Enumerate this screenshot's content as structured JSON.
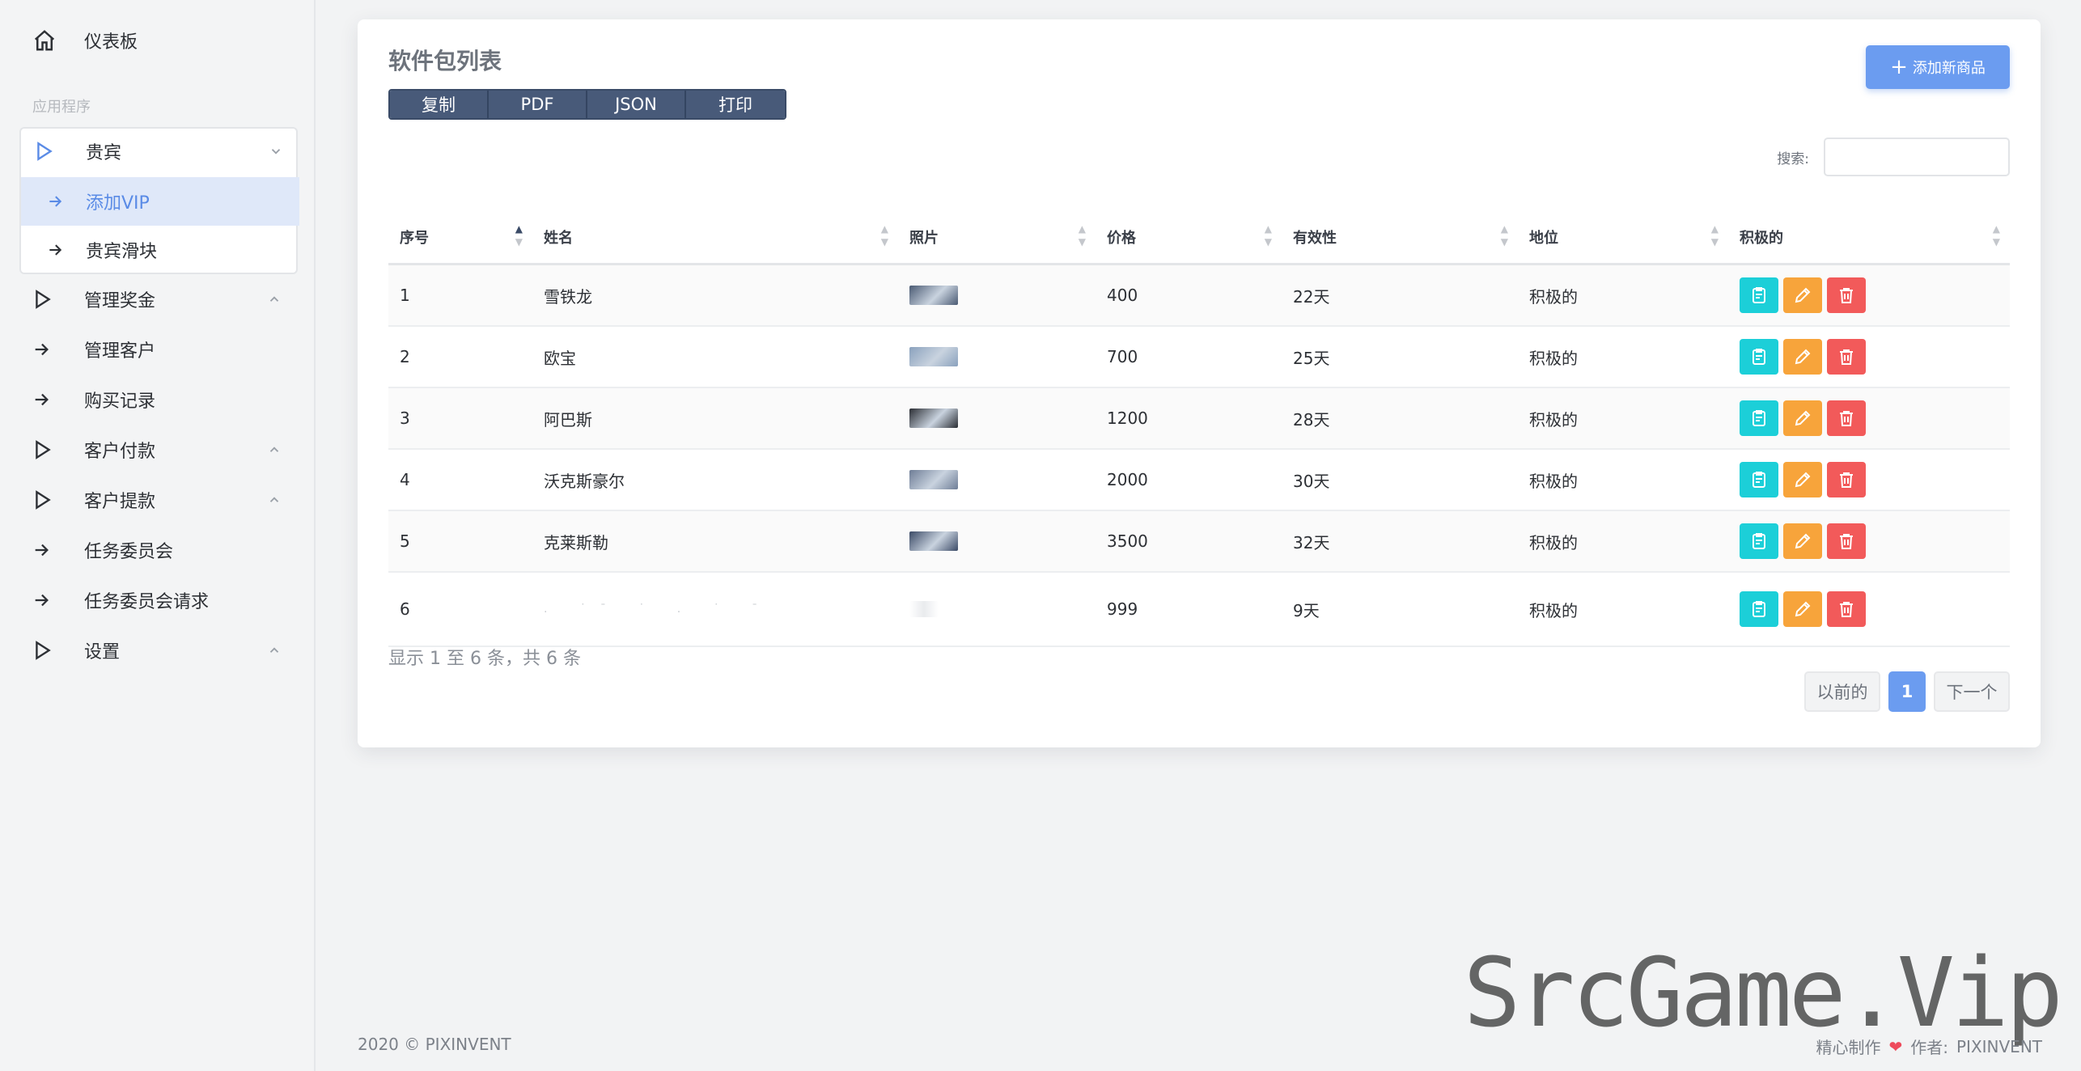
{
  "sidebar": {
    "dashboard": "仪表板",
    "section": "应用程序",
    "vip": {
      "label": "贵宾",
      "children": [
        "添加VIP",
        "贵宾滑块"
      ]
    },
    "items": [
      {
        "label": "管理奖金",
        "type": "group"
      },
      {
        "label": "管理客户",
        "type": "link"
      },
      {
        "label": "购买记录",
        "type": "link"
      },
      {
        "label": "客户付款",
        "type": "group"
      },
      {
        "label": "客户提款",
        "type": "group"
      },
      {
        "label": "任务委员会",
        "type": "link"
      },
      {
        "label": "任务委员会请求",
        "type": "link"
      },
      {
        "label": "设置",
        "type": "group"
      }
    ]
  },
  "card": {
    "title": "软件包列表",
    "export_buttons": [
      "复制",
      "PDF",
      "JSON",
      "打印"
    ],
    "add_button": "添加新商品",
    "search_label": "搜索:"
  },
  "table": {
    "headers": [
      "序号",
      "姓名",
      "照片",
      "价格",
      "有效性",
      "地位",
      "积极的"
    ],
    "rows": [
      {
        "id": "1",
        "name": "雪铁龙",
        "price": "400",
        "validity": "22天",
        "status": "积极的",
        "photo_color": "#4a5a73"
      },
      {
        "id": "2",
        "name": "欧宝",
        "price": "700",
        "validity": "25天",
        "status": "积极的",
        "photo_color": "#8aa1bd"
      },
      {
        "id": "3",
        "name": "阿巴斯",
        "price": "1200",
        "validity": "28天",
        "status": "积极的",
        "photo_color": "#2a2d33"
      },
      {
        "id": "4",
        "name": "沃克斯豪尔",
        "price": "2000",
        "validity": "30天",
        "status": "积极的",
        "photo_color": "#6e7d96"
      },
      {
        "id": "5",
        "name": "克莱斯勒",
        "price": "3500",
        "validity": "32天",
        "status": "积极的",
        "photo_color": "#3b4a66"
      },
      {
        "id": "6",
        "name": "",
        "price": "999",
        "validity": "9天",
        "status": "积极的",
        "photo_color": ""
      }
    ]
  },
  "footer_info": "显示 1 至 6 条，共 6 条",
  "pagination": {
    "prev": "以前的",
    "current": "1",
    "next": "下一个"
  },
  "footer": {
    "copyright": "2020 © PIXINVENT",
    "made_with": "精心制作",
    "author_label": "作者:",
    "author": "PIXINVENT"
  },
  "watermark": "SrcGame.Vip",
  "colors": {
    "accent": "#6b9cf0",
    "export_bg": "#485a79",
    "view": "#1ccfd8",
    "edit": "#f7a43b",
    "delete": "#f25a5a"
  }
}
